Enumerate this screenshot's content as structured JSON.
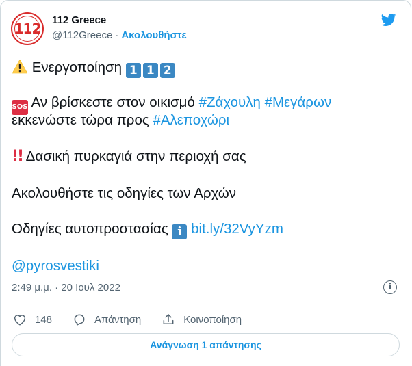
{
  "author": {
    "name": "112 Greece",
    "handle": "@112Greece",
    "separator": "·",
    "follow_label": "Ακολουθήστε",
    "avatar_text": "112"
  },
  "tweet": {
    "line1_text": "Ενεργοποίηση",
    "line1_keycaps": [
      "1",
      "1",
      "2"
    ],
    "sos_label": "SOS",
    "line2_text": "Αν βρίσκεστε στον οικισμό",
    "hashtag1": "#Ζάχουλη",
    "hashtag2": "#Μεγάρων",
    "line3_text": "εκκενώστε τώρα προς",
    "hashtag3": "#Αλεποχώρι",
    "bang": "!!",
    "line4_text": "Δασική πυρκαγιά στην περιοχή σας",
    "line5_text": "Ακολουθήστε τις οδηγίες των Αρχών",
    "line6_text": "Οδηγίες αυτοπροστασίας",
    "info_glyph": "i",
    "link": "bit.ly/32VyYzm",
    "mention": "@pyrosvestiki"
  },
  "meta": {
    "timestamp": "2:49 μ.μ. · 20 Ιουλ 2022"
  },
  "actions": {
    "like_count": "148",
    "reply_label": "Απάντηση",
    "share_label": "Κοινοποίηση"
  },
  "footer": {
    "read_replies_label": "Ανάγνωση 1 απάντησης"
  },
  "icons": {
    "warning": "warning-icon",
    "twitter": "twitter-bird-icon",
    "heart": "heart-icon",
    "reply": "reply-icon",
    "share": "share-icon",
    "info": "info-icon"
  },
  "colors": {
    "link": "#1b95e0",
    "text": "#0f1419",
    "muted": "#536471",
    "keycap": "#3b88c3",
    "sos": "#dd2e44",
    "border": "#cfd9de"
  }
}
